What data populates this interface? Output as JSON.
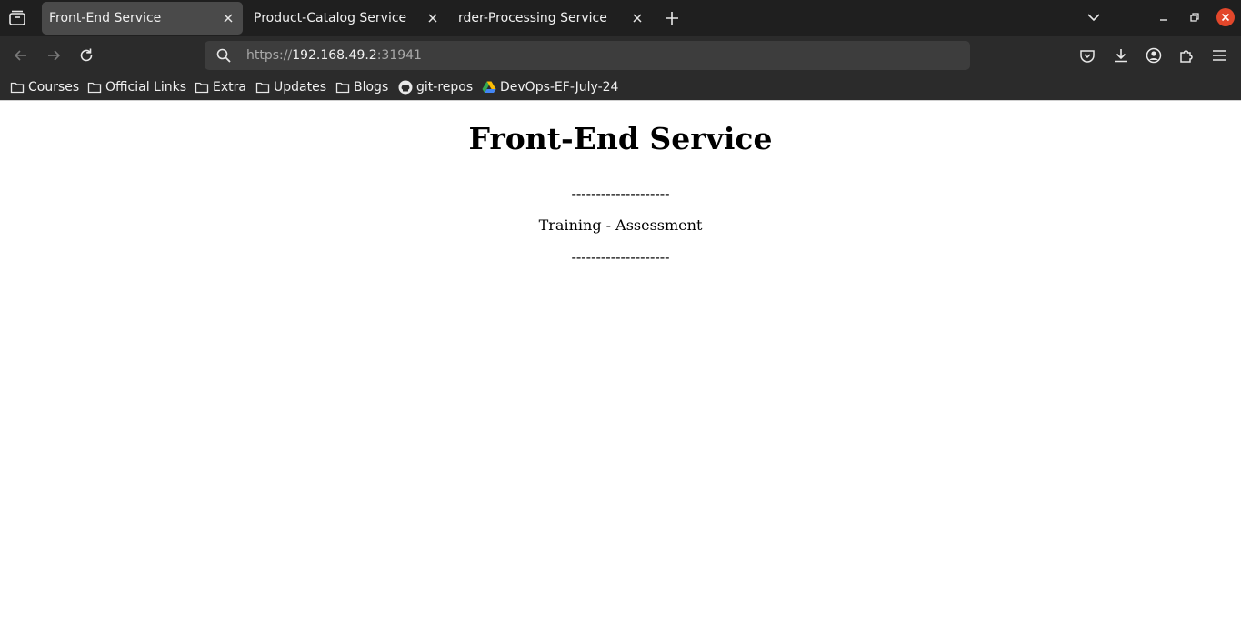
{
  "browser": {
    "tabs": [
      {
        "label": "Front-End Service",
        "active": true
      },
      {
        "label": "Product-Catalog Service",
        "active": false
      },
      {
        "label": "rder-Processing Service",
        "active": false
      }
    ],
    "url": {
      "scheme": "https://",
      "host": "192.168.49.2",
      "port": ":31941"
    },
    "bookmarks": [
      {
        "label": "Courses",
        "icon": "folder-icon"
      },
      {
        "label": "Official Links",
        "icon": "folder-icon"
      },
      {
        "label": "Extra",
        "icon": "folder-icon"
      },
      {
        "label": "Updates",
        "icon": "folder-icon"
      },
      {
        "label": "Blogs",
        "icon": "folder-icon"
      },
      {
        "label": "git-repos",
        "icon": "github-icon"
      },
      {
        "label": "DevOps-EF-July-24",
        "icon": "google-drive-icon"
      }
    ],
    "colors": {
      "tabstrip_bg": "#1f1f1f",
      "toolbar_bg": "#2b2b2b",
      "active_tab_bg": "#4a4a4a",
      "close_window": "#e2472b"
    }
  },
  "page": {
    "title": "Front-End Service",
    "separator_top": "--------------------",
    "subtitle": "Training - Assessment",
    "separator_bottom": "--------------------"
  }
}
